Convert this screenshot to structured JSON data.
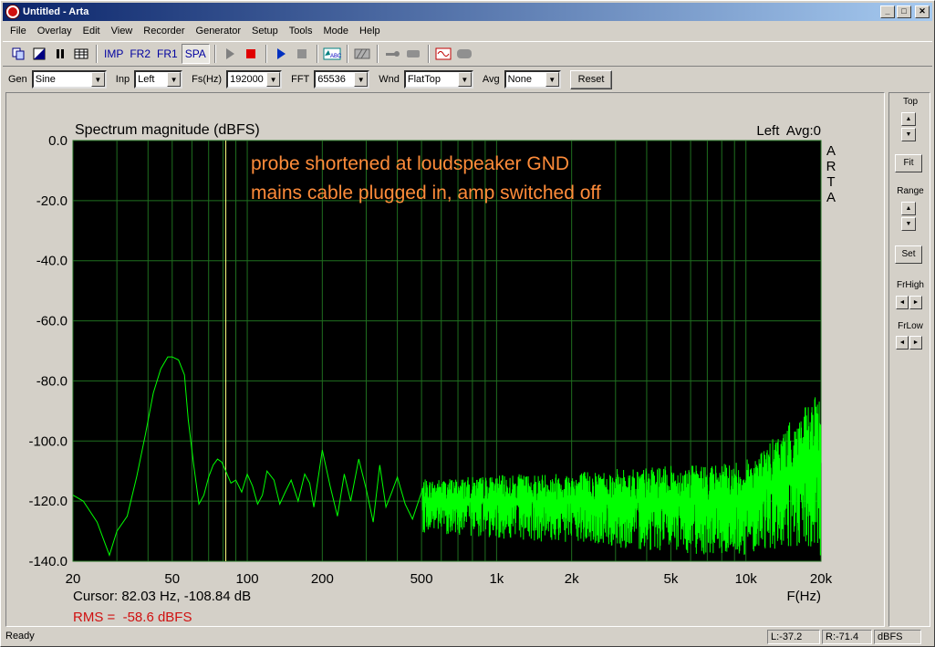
{
  "window": {
    "title": "Untitled - Arta"
  },
  "menu": [
    "File",
    "Overlay",
    "Edit",
    "View",
    "Recorder",
    "Generator",
    "Setup",
    "Tools",
    "Mode",
    "Help"
  ],
  "toolbar": {
    "imp": "IMP",
    "fr2": "FR2",
    "fr1": "FR1",
    "spa": "SPA"
  },
  "options": {
    "gen_label": "Gen",
    "gen_value": "Sine",
    "inp_label": "Inp",
    "inp_value": "Left",
    "fs_label": "Fs(Hz)",
    "fs_value": "192000",
    "fft_label": "FFT",
    "fft_value": "65536",
    "wnd_label": "Wnd",
    "wnd_value": "FlatTop",
    "avg_label": "Avg",
    "avg_value": "None",
    "reset_label": "Reset"
  },
  "plot": {
    "cursor_text": "Cursor: 82.03 Hz, -108.84 dB",
    "rms_text": "RMS =  -58.6 dBFS",
    "channel_text": "Left  Avg:0",
    "watermark": [
      "A",
      "R",
      "T",
      "A"
    ],
    "annotation_line1": "probe shortened at loudspeaker GND",
    "annotation_line2": "mains cable plugged in, amp switched off",
    "colors": {
      "trace": "#00ff00",
      "grid": "#1f6f1f",
      "cursor": "#ffff80",
      "annotation": "#ff8c3a",
      "rms": "#d01010"
    }
  },
  "chart_data": {
    "type": "line",
    "title": "Spectrum magnitude (dBFS)",
    "xlabel": "F(Hz)",
    "ylabel": "",
    "x_scale": "log",
    "xlim": [
      20,
      20000
    ],
    "ylim": [
      -140,
      0
    ],
    "x_ticks": [
      20,
      50,
      100,
      200,
      500,
      1000,
      2000,
      5000,
      10000,
      20000
    ],
    "x_tick_labels": [
      "20",
      "50",
      "100",
      "200",
      "500",
      "1k",
      "2k",
      "5k",
      "10k",
      "20k"
    ],
    "y_ticks": [
      0,
      -20,
      -40,
      -60,
      -80,
      -100,
      -120,
      -140
    ],
    "y_tick_labels": [
      "0.0",
      "-20.0",
      "-40.0",
      "-60.0",
      "-80.0",
      "-100.0",
      "-120.0",
      "-140.0"
    ],
    "cursor_x": 82.03,
    "series": [
      {
        "x": [
          20,
          22,
          25,
          28,
          30,
          33,
          36,
          39,
          42,
          45,
          48,
          50,
          53,
          56,
          58,
          61,
          64,
          67,
          70,
          73,
          76,
          79,
          82,
          86,
          90,
          95,
          100,
          105,
          110,
          115,
          120,
          128,
          135,
          142,
          150,
          160,
          170,
          178,
          185,
          200,
          215,
          230,
          245,
          260,
          280,
          300,
          320,
          340,
          360,
          380,
          400,
          430,
          460,
          500
        ],
        "y": [
          -118,
          -120,
          -127,
          -138,
          -130,
          -125,
          -112,
          -98,
          -84,
          -76,
          -72,
          -72,
          -73,
          -78,
          -93,
          -108,
          -121,
          -118,
          -112,
          -108,
          -106,
          -107,
          -110,
          -114,
          -113,
          -117,
          -111,
          -115,
          -121,
          -118,
          -110,
          -113,
          -121,
          -117,
          -113,
          -120,
          -111,
          -114,
          -122,
          -103,
          -115,
          -125,
          -111,
          -120,
          -106,
          -116,
          -127,
          -108,
          -122,
          -117,
          -112,
          -121,
          -126,
          -117
        ],
        "noise_from_hz": 500,
        "noise_floor_db": -120
      }
    ]
  },
  "side": {
    "top": "Top",
    "fit": "Fit",
    "range": "Range",
    "set": "Set",
    "frhigh": "FrHigh",
    "frlow": "FrLow"
  },
  "status": {
    "ready": "Ready",
    "l": "L:-37.2",
    "r": "R:-71.4",
    "unit": "dBFS"
  }
}
